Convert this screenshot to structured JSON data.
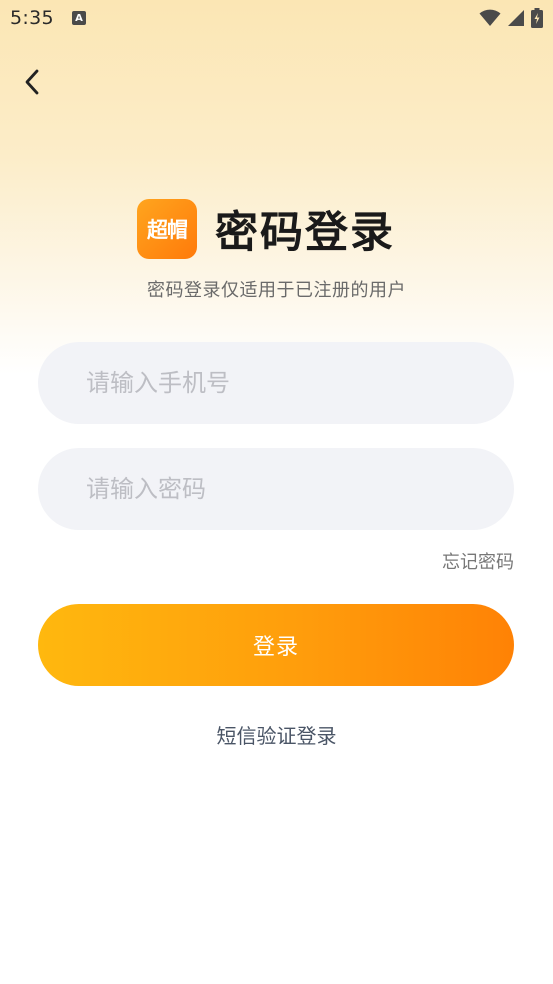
{
  "status_bar": {
    "time": "5:35",
    "a_icon_label": "A",
    "icons": [
      "wifi-icon",
      "signal-icon",
      "battery-icon"
    ]
  },
  "header": {
    "back_icon": "chevron-left-icon"
  },
  "title": {
    "logo_text": "超帽",
    "heading": "密码登录",
    "subtitle": "密码登录仅适用于已注册的用户"
  },
  "form": {
    "phone_placeholder": "请输入手机号",
    "phone_value": "",
    "password_placeholder": "请输入密码",
    "password_value": "",
    "forgot_label": "忘记密码",
    "login_label": "登录",
    "sms_login_label": "短信验证登录"
  },
  "colors": {
    "accent_start": "#ffb80e",
    "accent_end": "#ff8205",
    "input_bg": "#f2f3f7",
    "logo_orange": "#ff8a12"
  }
}
